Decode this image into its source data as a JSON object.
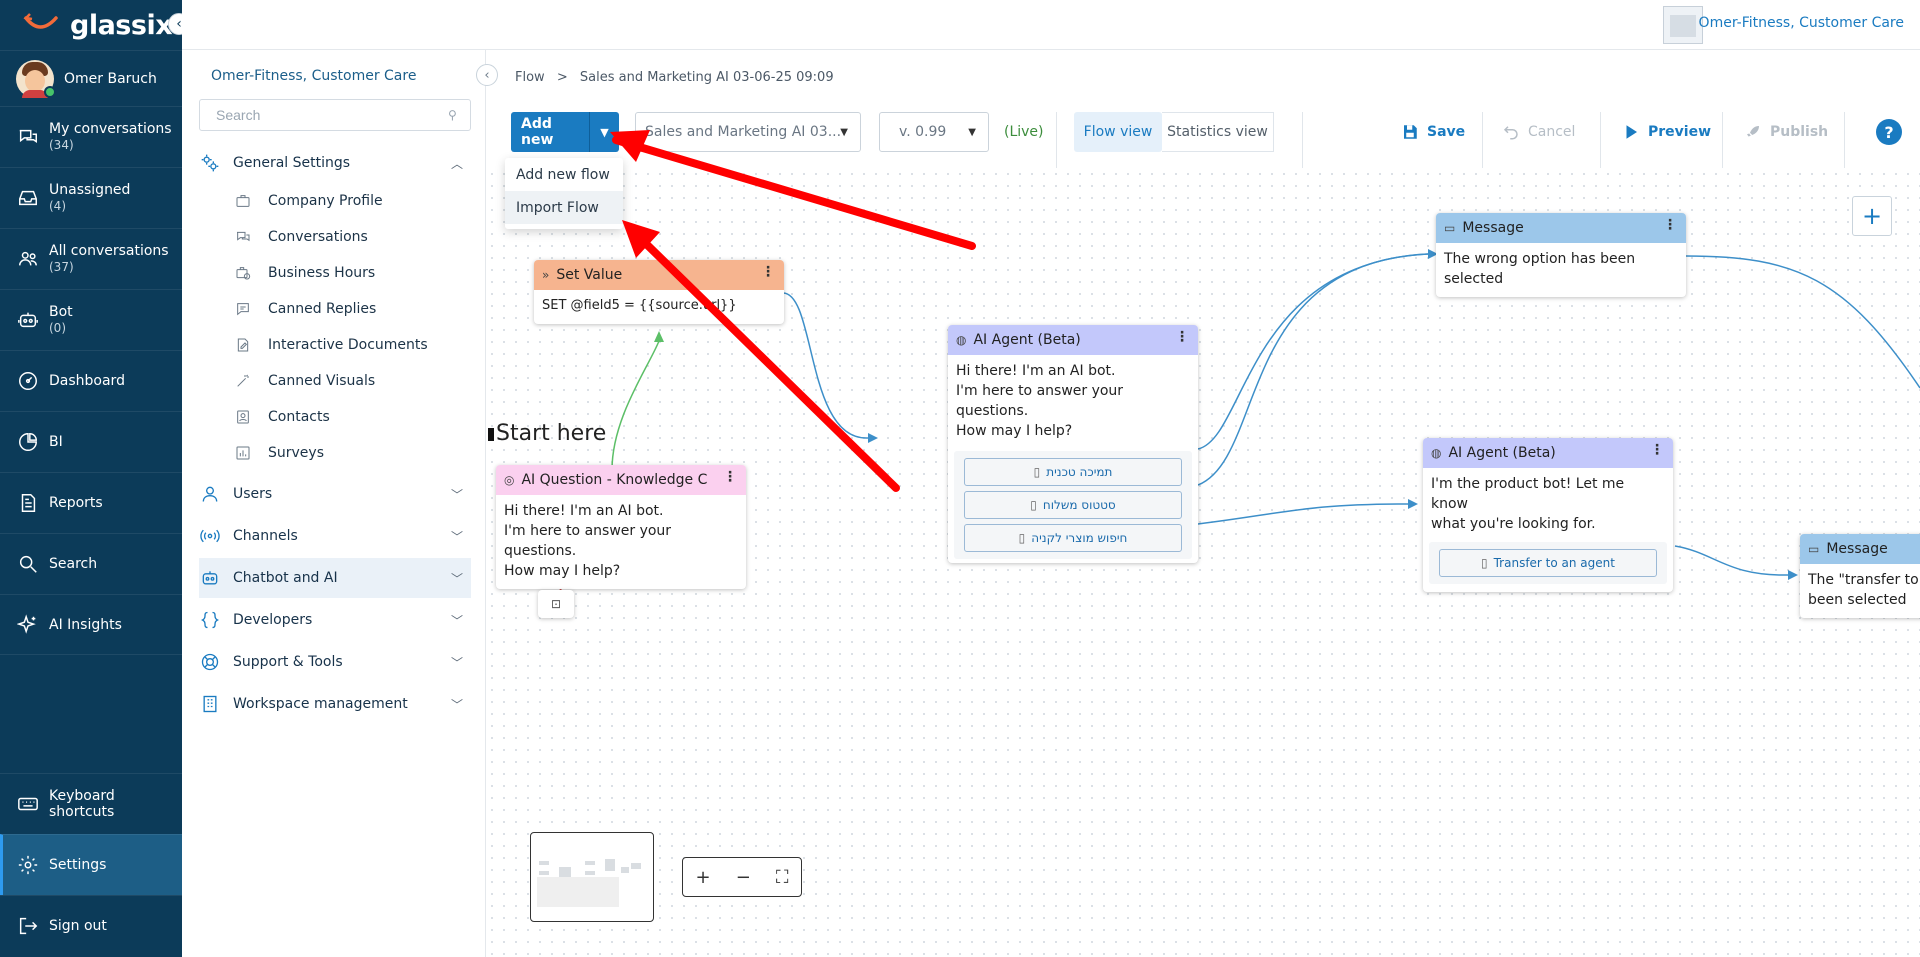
{
  "app": {
    "brand": "glassix",
    "workspace": "Omer-Fitness, Customer Care"
  },
  "user": {
    "name": "Omer Baruch"
  },
  "nav": {
    "items": [
      {
        "label": "My conversations",
        "count": "(34)",
        "icon": "chat-bubbles-icon"
      },
      {
        "label": "Unassigned",
        "count": "(4)",
        "icon": "inbox-icon"
      },
      {
        "label": "All conversations",
        "count": "(37)",
        "icon": "people-icon"
      },
      {
        "label": "Bot",
        "count": "(0)",
        "icon": "robot-icon"
      },
      {
        "label": "Dashboard",
        "count": "",
        "icon": "gauge-icon"
      },
      {
        "label": "BI",
        "count": "",
        "icon": "pie-icon"
      },
      {
        "label": "Reports",
        "count": "",
        "icon": "report-icon"
      },
      {
        "label": "Search",
        "count": "",
        "icon": "search-icon"
      },
      {
        "label": "AI Insights",
        "count": "",
        "icon": "sparkle-icon"
      }
    ],
    "keyboard": "Keyboard shortcuts",
    "settings": "Settings",
    "signout": "Sign out"
  },
  "settings_panel": {
    "title": "Omer-Fitness, Customer Care",
    "search_placeholder": "Search",
    "general": "General Settings",
    "sub": [
      "Company Profile",
      "Conversations",
      "Business Hours",
      "Canned Replies",
      "Interactive Documents",
      "Canned Visuals",
      "Contacts",
      "Surveys"
    ],
    "sections": [
      "Users",
      "Channels",
      "Chatbot and AI",
      "Developers",
      "Support & Tools",
      "Workspace management"
    ]
  },
  "breadcrumb": {
    "root": "Flow",
    "sep": ">",
    "current": "Sales and Marketing AI 03-06-25 09:09"
  },
  "toolbar": {
    "add_new": "Add new",
    "flow_select": "Sales and Marketing AI 03...",
    "version": "v. 0.99",
    "live": "(Live)",
    "flow_view": "Flow view",
    "stats_view": "Statistics view",
    "save": "Save",
    "cancel": "Cancel",
    "preview": "Preview",
    "publish": "Publish",
    "help": "?"
  },
  "dropdown": [
    "Add new flow",
    "Import Flow"
  ],
  "canvas": {
    "start_here": "Start here",
    "nodes": {
      "set_value": {
        "title": "Set Value",
        "body": "SET @field5 = {{source.url}}"
      },
      "ai_question": {
        "title": "AI Question - Knowledge C",
        "body": [
          "Hi there! I'm an AI bot.",
          "I'm here to answer your questions.",
          "How may I help?"
        ]
      },
      "ai_agent1": {
        "title": "AI Agent (Beta)",
        "body": [
          "Hi there! I'm an AI bot.",
          "I'm here to answer your questions.",
          "How may I help?"
        ],
        "buttons": [
          "תמיכה טכנית",
          "סטטוס משלוח",
          "חיפוש מוצרי לקניה"
        ]
      },
      "message1": {
        "title": "Message",
        "body": [
          "The wrong option has been",
          "selected"
        ]
      },
      "ai_agent2": {
        "title": "AI Agent (Beta)",
        "body": [
          "I'm the product bot! Let me know",
          "what you're looking for."
        ],
        "buttons": [
          "Transfer to an agent"
        ]
      },
      "message2": {
        "title": "Message",
        "body": [
          "The \"transfer to a",
          "been selected"
        ]
      }
    }
  },
  "colors": {
    "nav_bg": "#0c3b59",
    "accent": "#1a7bc1",
    "set_value_head": "#f6b48f",
    "ai_question_head": "#fbd0ef",
    "ai_agent_head": "#c3c8fb",
    "message_head": "#9cc7ea",
    "annotation_arrow": "#ff0000"
  }
}
